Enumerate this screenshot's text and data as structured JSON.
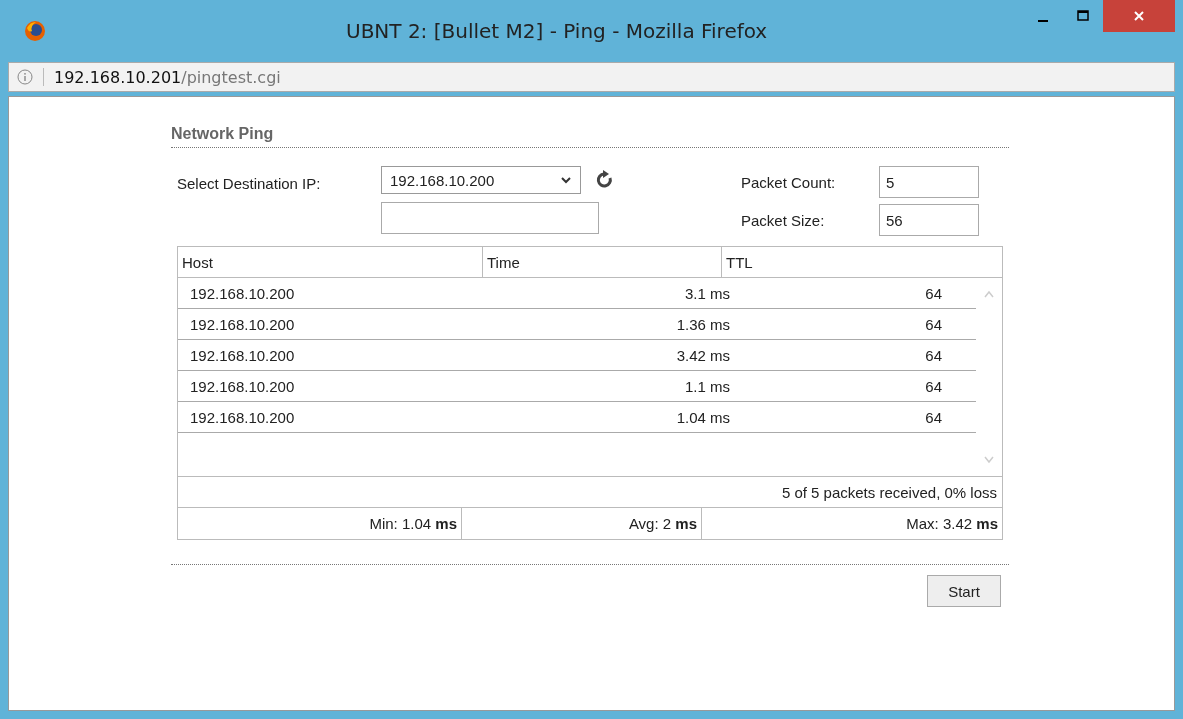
{
  "window": {
    "title": "UBNT 2: [Bullet M2] - Ping - Mozilla Firefox"
  },
  "address_bar": {
    "host": "192.168.10.201",
    "path": "/pingtest.cgi"
  },
  "section_title": "Network Ping",
  "destination": {
    "label": "Select Destination IP:",
    "value": "192.168.10.200"
  },
  "packet_count": {
    "label": "Packet Count:",
    "value": "5"
  },
  "packet_size": {
    "label": "Packet Size:",
    "value": "56"
  },
  "table": {
    "columns": [
      "Host",
      "Time",
      "TTL"
    ],
    "rows": [
      {
        "host": "192.168.10.200",
        "time": "3.1 ms",
        "ttl": "64"
      },
      {
        "host": "192.168.10.200",
        "time": "1.36 ms",
        "ttl": "64"
      },
      {
        "host": "192.168.10.200",
        "time": "3.42 ms",
        "ttl": "64"
      },
      {
        "host": "192.168.10.200",
        "time": "1.1 ms",
        "ttl": "64"
      },
      {
        "host": "192.168.10.200",
        "time": "1.04 ms",
        "ttl": "64"
      }
    ]
  },
  "summary": "5 of 5 packets received, 0% loss",
  "stats": [
    "Min: 1.04 **ms**",
    "Avg: 2 **ms**",
    "Max: 3.42 **ms**"
  ],
  "start_button": "Start"
}
